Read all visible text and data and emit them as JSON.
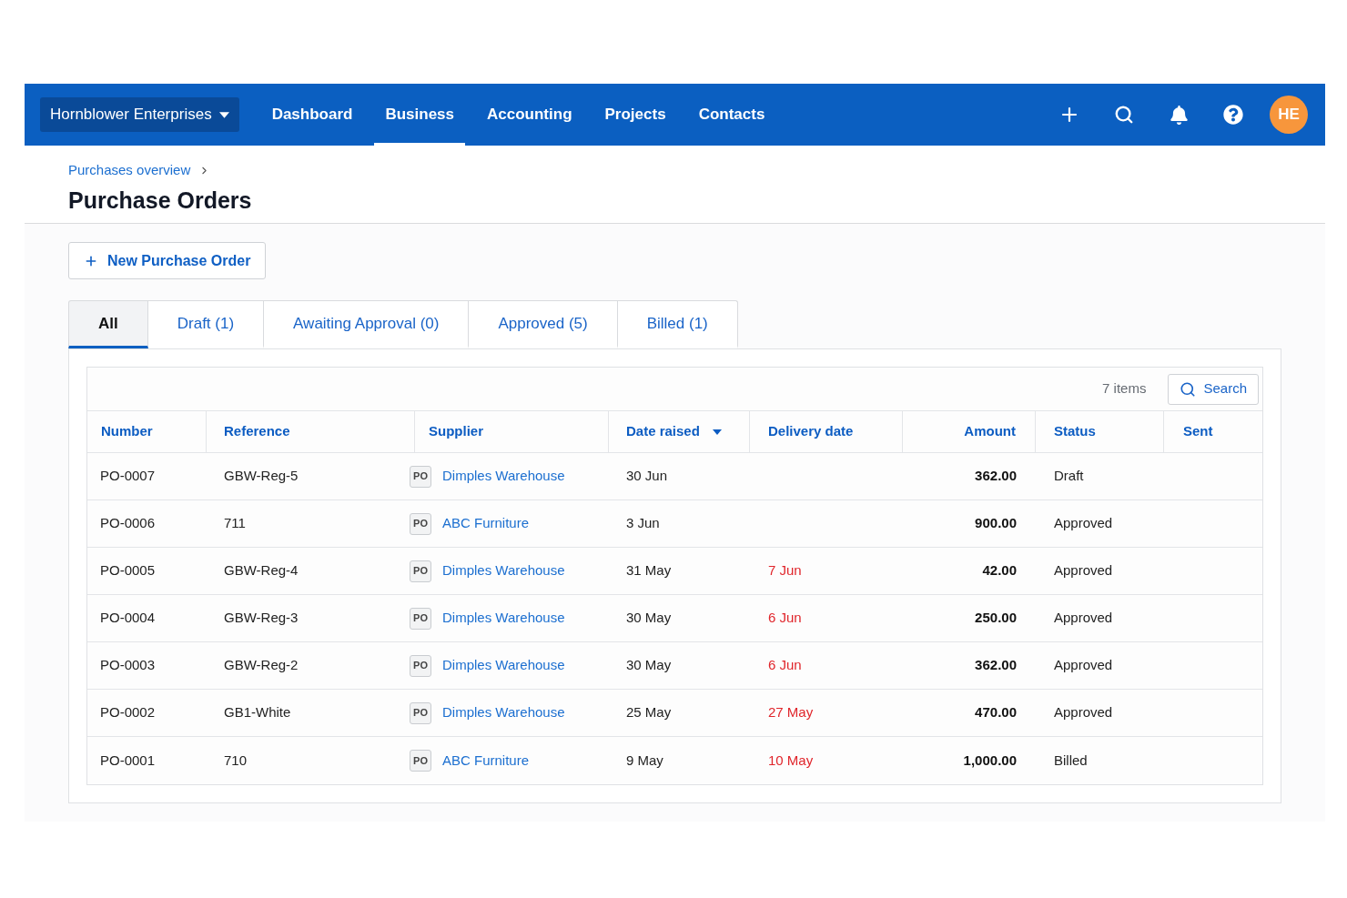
{
  "nav": {
    "organisation": "Hornblower Enterprises",
    "items": [
      {
        "label": "Dashboard",
        "selected": false
      },
      {
        "label": "Business",
        "selected": true
      },
      {
        "label": "Accounting",
        "selected": false
      },
      {
        "label": "Projects",
        "selected": false
      },
      {
        "label": "Contacts",
        "selected": false
      }
    ],
    "avatar": "HE"
  },
  "breadcrumb": [
    {
      "label": "Purchases overview"
    }
  ],
  "title": "Purchase Orders",
  "new_button": "New Purchase Order",
  "tabs": [
    {
      "label": "All",
      "selected": true
    },
    {
      "label": "Draft (1)",
      "selected": false
    },
    {
      "label": "Awaiting Approval (0)",
      "selected": false
    },
    {
      "label": "Approved (5)",
      "selected": false
    },
    {
      "label": "Billed (1)",
      "selected": false
    }
  ],
  "table": {
    "item_count": "7 items",
    "search_button": "Search",
    "columns": [
      {
        "label": "Number",
        "sorted": false
      },
      {
        "label": "Reference",
        "sorted": false
      },
      {
        "label": "Supplier",
        "sorted": false
      },
      {
        "label": "Date raised",
        "sorted": true
      },
      {
        "label": "Delivery date",
        "sorted": false
      },
      {
        "label": "Amount",
        "sorted": false
      },
      {
        "label": "Status",
        "sorted": false
      },
      {
        "label": "Sent",
        "sorted": false
      }
    ],
    "rows": [
      {
        "number": "PO-0007",
        "reference": "GBW-Reg-5",
        "supplier_tag": "PO",
        "supplier": "Dimples Warehouse",
        "date_raised": "30 Jun",
        "amount": "362.00",
        "status": "Draft"
      },
      {
        "number": "PO-0006",
        "reference": "711",
        "supplier_tag": "PO",
        "supplier": "ABC Furniture",
        "date_raised": "3 Jun",
        "amount": "900.00",
        "status": "Approved"
      },
      {
        "number": "PO-0005",
        "reference": "GBW-Reg-4",
        "supplier_tag": "PO",
        "supplier": "Dimples Warehouse",
        "date_raised": "31 May",
        "delivery_date": "7 Jun",
        "overdue": true,
        "amount": "42.00",
        "status": "Approved"
      },
      {
        "number": "PO-0004",
        "reference": "GBW-Reg-3",
        "supplier_tag": "PO",
        "supplier": "Dimples Warehouse",
        "date_raised": "30 May",
        "delivery_date": "6 Jun",
        "overdue": true,
        "amount": "250.00",
        "status": "Approved"
      },
      {
        "number": "PO-0003",
        "reference": "GBW-Reg-2",
        "supplier_tag": "PO",
        "supplier": "Dimples Warehouse",
        "date_raised": "30 May",
        "delivery_date": "6 Jun",
        "overdue": true,
        "amount": "362.00",
        "status": "Approved"
      },
      {
        "number": "PO-0002",
        "reference": "GB1-White",
        "supplier_tag": "PO",
        "supplier": "Dimples Warehouse",
        "date_raised": "25 May",
        "delivery_date": "27 May",
        "overdue": true,
        "amount": "470.00",
        "status": "Approved"
      },
      {
        "number": "PO-0001",
        "reference": "710",
        "supplier_tag": "PO",
        "supplier": "ABC Furniture",
        "date_raised": "9 May",
        "delivery_date": "10 May",
        "overdue": true,
        "amount": "1,000.00",
        "status": "Billed"
      }
    ]
  }
}
